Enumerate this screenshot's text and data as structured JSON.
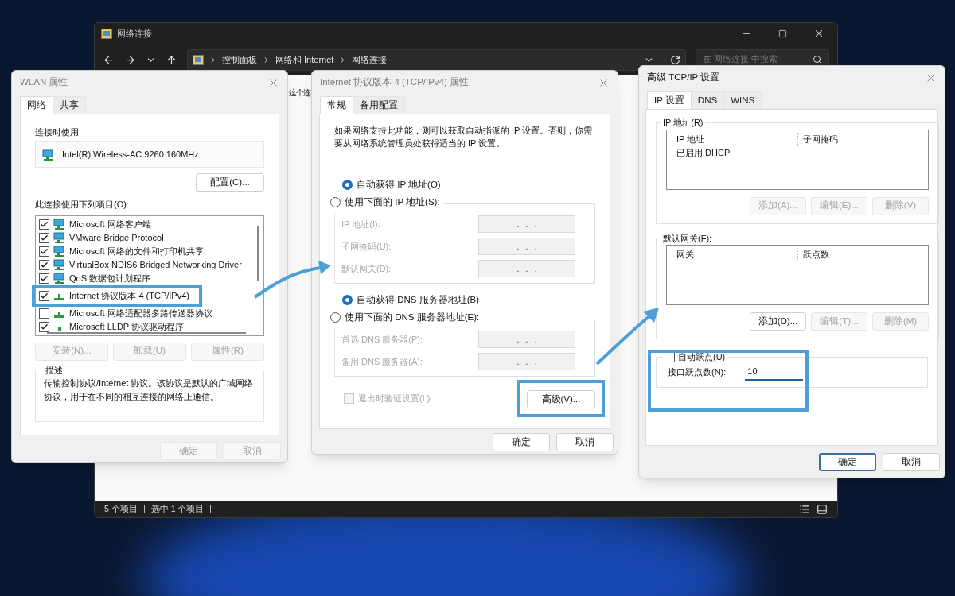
{
  "explorer": {
    "title": "网络连接",
    "breadcrumbs": [
      "控制面板",
      "网络和 Internet",
      "网络连接"
    ],
    "search": {
      "placeholder": "在 网络连接 中搜索"
    },
    "toolbar_text": "这个连",
    "status": [
      "5 个项目",
      "选中 1 个项目"
    ]
  },
  "wlan_dialog": {
    "title": "WLAN 属性",
    "tabs": [
      {
        "label": "网络",
        "selected": true
      },
      {
        "label": "共享",
        "selected": false
      }
    ],
    "connect_using_label": "连接时使用:",
    "adapter": "Intel(R) Wireless-AC 9260 160MHz",
    "configure_button": "配置(C)...",
    "items_label": "此连接使用下列项目(O):",
    "items": [
      {
        "label": "Microsoft 网络客户端",
        "kind": "client",
        "checked": true,
        "highlighted": false
      },
      {
        "label": "VMware Bridge Protocol",
        "kind": "client",
        "checked": true,
        "highlighted": false
      },
      {
        "label": "Microsoft 网络的文件和打印机共享",
        "kind": "client",
        "checked": true,
        "highlighted": false
      },
      {
        "label": "VirtualBox NDIS6 Bridged Networking Driver",
        "kind": "client",
        "checked": true,
        "highlighted": false
      },
      {
        "label": "QoS 数据包计划程序",
        "kind": "client",
        "checked": true,
        "highlighted": false
      },
      {
        "label": "Internet 协议版本 4 (TCP/IPv4)",
        "kind": "protocol",
        "checked": true,
        "highlighted": true
      },
      {
        "label": "Microsoft 网络适配器多路传送器协议",
        "kind": "protocol",
        "checked": false,
        "highlighted": false
      },
      {
        "label": "Microsoft LLDP 协议驱动程序",
        "kind": "driver",
        "checked": true,
        "highlighted": false
      }
    ],
    "buttons": [
      {
        "label": "安装(N)...",
        "disabled": true
      },
      {
        "label": "卸载(U)",
        "disabled": true
      },
      {
        "label": "属性(R)",
        "disabled": true
      }
    ],
    "description_label": "描述",
    "description": "传输控制协议/Internet 协议。该协议是默认的广域网络协议，用于在不同的相互连接的网络上通信。",
    "footer_buttons": [
      {
        "label": "确定",
        "disabled": true
      },
      {
        "label": "取消",
        "disabled": true
      }
    ]
  },
  "ipv4_dialog": {
    "title": "Internet 协议版本 4 (TCP/IPv4) 属性",
    "tabs": [
      {
        "label": "常规",
        "selected": true
      },
      {
        "label": "备用配置",
        "selected": false
      }
    ],
    "intro": "如果网络支持此功能，则可以获取自动指派的 IP 设置。否则，你需要从网络系统管理员处获得适当的 IP 设置。",
    "ip_options": [
      {
        "label": "自动获得 IP 地址(O)",
        "selected": true
      },
      {
        "label": "使用下面的 IP 地址(S):",
        "selected": false
      }
    ],
    "ip_fields": [
      {
        "label": "IP 地址(I):",
        "value": ".   .   .",
        "disabled": true
      },
      {
        "label": "子网掩码(U):",
        "value": ".   .   .",
        "disabled": true
      },
      {
        "label": "默认网关(D):",
        "value": ".   .   .",
        "disabled": true
      }
    ],
    "dns_options": [
      {
        "label": "自动获得 DNS 服务器地址(B)",
        "selected": true
      },
      {
        "label": "使用下面的 DNS 服务器地址(E):",
        "selected": false
      }
    ],
    "dns_fields": [
      {
        "label": "首选 DNS 服务器(P):",
        "value": ".   .   .",
        "disabled": true
      },
      {
        "label": "备用 DNS 服务器(A):",
        "value": ".   .   .",
        "disabled": true
      }
    ],
    "validate": {
      "label": "退出时验证设置(L)",
      "checked": false,
      "disabled": true
    },
    "advanced_button": {
      "label": "高级(V)...",
      "highlighted": true
    },
    "footer_buttons": [
      {
        "label": "确定",
        "disabled": false
      },
      {
        "label": "取消",
        "disabled": false
      }
    ]
  },
  "advanced_dialog": {
    "title": "高级 TCP/IP 设置",
    "tabs": [
      {
        "label": "IP 设置",
        "selected": true
      },
      {
        "label": "DNS",
        "selected": false
      },
      {
        "label": "WINS",
        "selected": false
      }
    ],
    "ip_group": {
      "label": "IP 地址(R)",
      "columns": [
        "IP 地址",
        "子网掩码"
      ],
      "rows": [
        [
          "已启用 DHCP"
        ]
      ],
      "buttons": [
        {
          "label": "添加(A)...",
          "disabled": true
        },
        {
          "label": "编辑(E)...",
          "disabled": true
        },
        {
          "label": "删除(V)",
          "disabled": true
        }
      ]
    },
    "gateway_group": {
      "label": "默认网关(F):",
      "columns": [
        "网关",
        "跃点数"
      ],
      "buttons": [
        {
          "label": "添加(D)...",
          "disabled": false
        },
        {
          "label": "编辑(T)...",
          "disabled": true
        },
        {
          "label": "删除(M)",
          "disabled": true
        }
      ]
    },
    "metric": {
      "auto_label": "自动跃点(U)",
      "auto_checked": false,
      "label": "接口跃点数(N):",
      "value": "10",
      "highlighted": true
    },
    "footer_buttons": [
      {
        "label": "确定",
        "disabled": false
      },
      {
        "label": "取消",
        "disabled": false
      }
    ]
  }
}
